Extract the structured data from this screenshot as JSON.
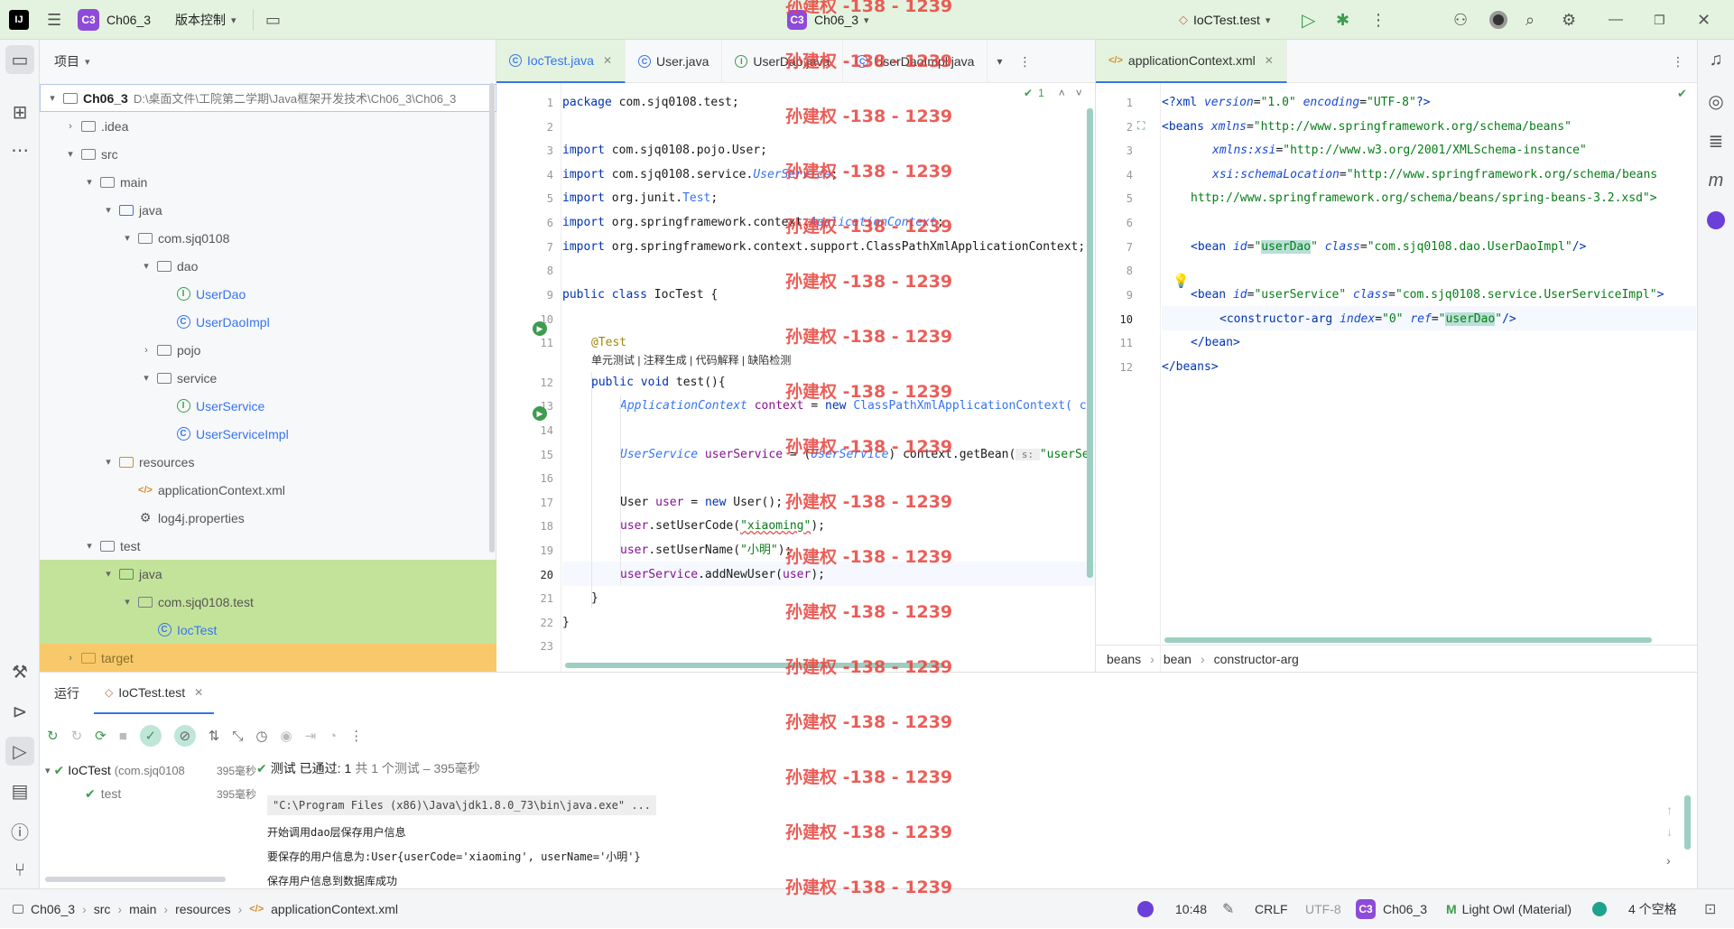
{
  "topbar": {
    "project_badge": "C3",
    "project_name": "Ch06_3",
    "vcs_label": "版本控制",
    "center_badge": "C3",
    "center_project": "Ch06_3",
    "run_config": "IoCTest.test"
  },
  "watermark": "孙建权 -138 - 1239",
  "project_panel": {
    "title": "项目",
    "items": [
      {
        "label": "Ch06_3",
        "path": "D:\\桌面文件\\工院第二学期\\Java框架开发技术\\Ch06_3\\Ch06_3",
        "icon": "module-icon"
      },
      {
        "label": ".idea",
        "icon": "folder-icon"
      },
      {
        "label": "src",
        "icon": "folder-icon"
      },
      {
        "label": "main",
        "icon": "folder-icon"
      },
      {
        "label": "java",
        "icon": "source-folder-icon"
      },
      {
        "label": "com.sjq0108",
        "icon": "package-icon"
      },
      {
        "label": "dao",
        "icon": "package-icon"
      },
      {
        "label": "UserDao",
        "icon": "interface-icon"
      },
      {
        "label": "UserDaoImpl",
        "icon": "class-icon"
      },
      {
        "label": "pojo",
        "icon": "package-icon"
      },
      {
        "label": "service",
        "icon": "package-icon"
      },
      {
        "label": "UserService",
        "icon": "interface-icon"
      },
      {
        "label": "UserServiceImpl",
        "icon": "class-icon"
      },
      {
        "label": "resources",
        "icon": "resources-folder-icon"
      },
      {
        "label": "applicationContext.xml",
        "icon": "xml-file-icon"
      },
      {
        "label": "log4j.properties",
        "icon": "properties-file-icon"
      },
      {
        "label": "test",
        "icon": "folder-icon"
      },
      {
        "label": "java",
        "icon": "test-source-folder-icon"
      },
      {
        "label": "com.sjq0108.test",
        "icon": "package-icon"
      },
      {
        "label": "IocTest",
        "icon": "test-class-icon"
      },
      {
        "label": "target",
        "icon": "excluded-folder-icon"
      }
    ]
  },
  "editor_left": {
    "tabs": [
      "IocTest.java",
      "User.java",
      "UserDao.java",
      "UserDaoImpl.java"
    ],
    "inspection_count": "1",
    "line_numbers": [
      "1",
      "2",
      "3",
      "4",
      "5",
      "6",
      "7",
      "8",
      "9",
      "10",
      "11",
      "12",
      "13",
      "14",
      "15",
      "16",
      "17",
      "18",
      "19",
      "20",
      "21",
      "22",
      "23"
    ],
    "code": {
      "l1_a": "package ",
      "l1_b": "com.sjq0108.test;",
      "l3_a": "import ",
      "l3_b": "com.sjq0108.pojo.User;",
      "l4_a": "import ",
      "l4_b": "com.sjq0108.service.",
      "l4_c": "UserService",
      "l4_d": ";",
      "l5_a": "import ",
      "l5_b": "org.junit.",
      "l5_c": "Test",
      "l5_d": ";",
      "l6_a": "import ",
      "l6_b": "org.springframework.context.",
      "l6_c": "ApplicationContext",
      "l6_d": ";",
      "l7_a": "import ",
      "l7_b": "org.springframework.context.support.ClassPathXmlApplicationContext;",
      "l9_a": "public class ",
      "l9_b": "IocTest {",
      "l11": "@Test",
      "inlay_hint": "单元测试 | 注释生成 | 代码解释 | 缺陷检测",
      "l12_a": "public void ",
      "l12_b": "test(){",
      "l13_a": "ApplicationContext ",
      "l13_b": "context",
      "l13_c": " = ",
      "l13_d": "new ",
      "l13_e": "ClassPathXmlApplicationContext( c",
      "l15_a": "UserService ",
      "l15_b": "userService",
      "l15_c": " = (",
      "l15_d": "UserService",
      "l15_e": ") context.getBean(",
      "l15_f": " s: ",
      "l15_g": "\"userSe",
      "l17_a": "User ",
      "l17_b": "user",
      "l17_c": " = ",
      "l17_d": "new ",
      "l17_e": "User();",
      "l18_a": "user",
      "l18_b": ".setUserCode(",
      "l18_c": "\"xiaoming\"",
      "l18_d": ");",
      "l19_a": "user",
      "l19_b": ".setUserName(",
      "l19_c": "\"小明\"",
      "l19_d": ");",
      "l20_a": "userService",
      "l20_b": ".addNewUser(",
      "l20_c": "user",
      "l20_d": ");",
      "l21": "}",
      "l22": "}"
    }
  },
  "editor_right": {
    "tab": "applicationContext.xml",
    "line_numbers": [
      "1",
      "2",
      "3",
      "4",
      "5",
      "6",
      "7",
      "8",
      "9",
      "10",
      "11",
      "12"
    ],
    "xml": {
      "l1_a": "<?xml ",
      "l1_b": "version",
      "l1_c": "=",
      "l1_d": "\"1.0\" ",
      "l1_e": "encoding",
      "l1_f": "=",
      "l1_g": "\"UTF-8\"",
      "l1_h": "?>",
      "l2_a": "<beans ",
      "l2_b": "xmlns",
      "l2_c": "=",
      "l2_d": "\"http://www.springframework.org/schema/beans\"",
      "l3_a": "xmlns:xsi",
      "l3_b": "=",
      "l3_c": "\"http://www.w3.org/2001/XMLSchema-instance\"",
      "l4_a": "xsi:schemaLocation",
      "l4_b": "=",
      "l4_c": "\"http://www.springframework.org/schema/beans",
      "l5": "http://www.springframework.org/schema/beans/spring-beans-3.2.xsd\">",
      "l7_a": "<bean ",
      "l7_b": "id",
      "l7_c": "=",
      "l7_d": "\"",
      "l7_e": "userDao",
      "l7_f": "\" ",
      "l7_g": "class",
      "l7_h": "=",
      "l7_i": "\"com.sjq0108.dao.UserDaoImpl\"",
      "l7_j": "/>",
      "l9_a": "<bean ",
      "l9_b": "id",
      "l9_c": "=",
      "l9_d": "\"userService\" ",
      "l9_e": "class",
      "l9_f": "=",
      "l9_g": "\"com.sjq0108.service.UserServiceImpl\"",
      "l9_h": ">",
      "l10_a": "<constructor-arg ",
      "l10_b": "index",
      "l10_c": "=",
      "l10_d": "\"0\" ",
      "l10_e": "ref",
      "l10_f": "=",
      "l10_g": "\"",
      "l10_h": "userDao",
      "l10_i": "\"",
      "l10_j": "/>",
      "l11": "</bean>",
      "l12": "</beans>"
    },
    "breadcrumbs": [
      "beans",
      "bean",
      "constructor-arg"
    ]
  },
  "bottom_panel": {
    "tab_run": "运行",
    "tab_config": "IoCTest.test",
    "tree": [
      {
        "label": "IoCTest",
        "detail": "(com.sjq0108",
        "time": "395毫秒"
      },
      {
        "label": "test",
        "detail": "",
        "time": "395毫秒"
      }
    ],
    "status_label": "测试 已通过: ",
    "status_count": "1",
    "status_detail": "共 1 个测试 – 395毫秒",
    "output": [
      "\"C:\\Program Files (x86)\\Java\\jdk1.8.0_73\\bin\\java.exe\" ...",
      "开始调用dao层保存用户信息",
      "要保存的用户信息为:User{userCode='xiaoming', userName='小明'}",
      "保存用户信息到数据库成功"
    ]
  },
  "statusbar": {
    "breadcrumbs": [
      "Ch06_3",
      "src",
      "main",
      "resources",
      "applicationContext.xml"
    ],
    "position": "10:48",
    "line_separator": "CRLF",
    "encoding": "UTF-8",
    "project_badge": "C3",
    "project": "Ch06_3",
    "theme": "Light Owl (Material)",
    "indent": "4 个空格"
  }
}
